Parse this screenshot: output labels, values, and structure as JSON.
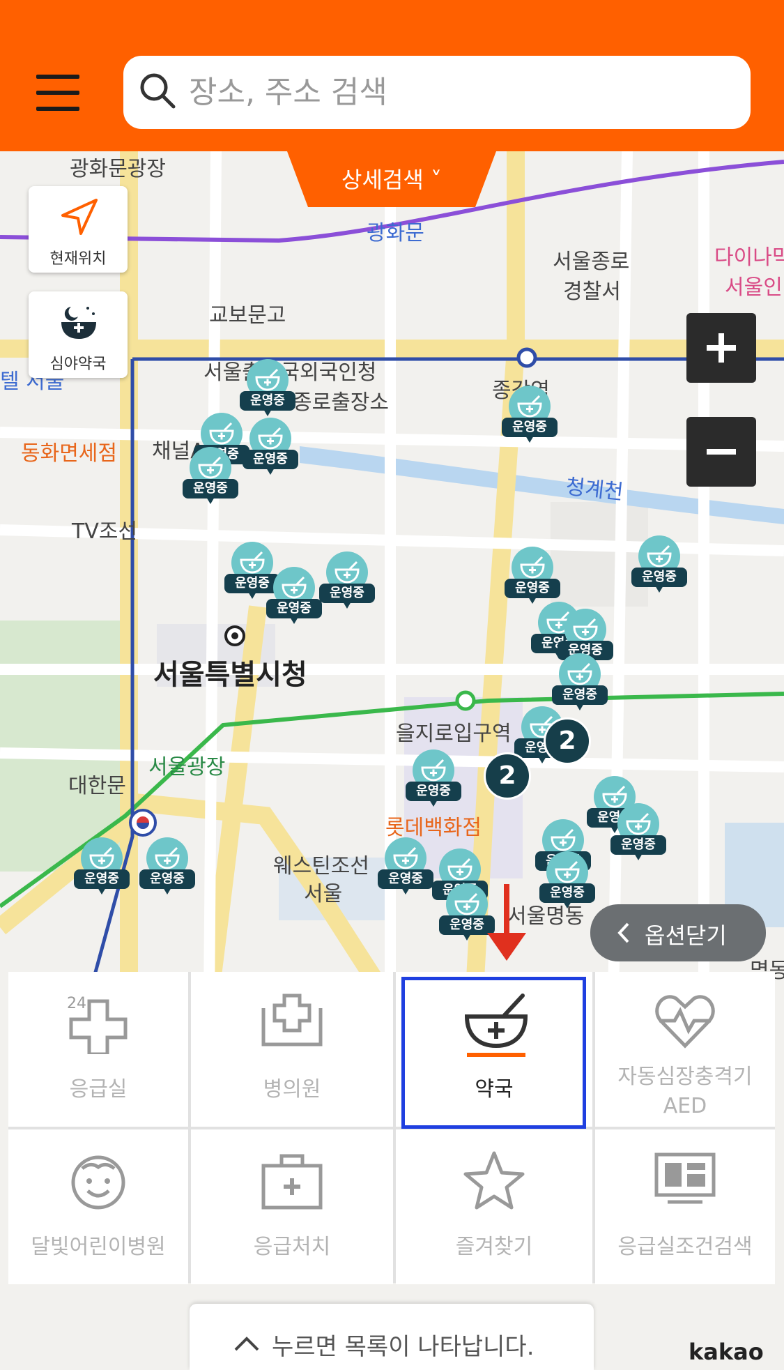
{
  "header": {
    "search_placeholder": "장소, 주소 검색",
    "detail_search_label": "상세검색",
    "brand_color": "#ff6000"
  },
  "side_buttons": {
    "current_location": "현재위치",
    "night_pharmacy": "심야약국"
  },
  "zoom": {
    "in_label": "+",
    "out_label": "−"
  },
  "map_labels": {
    "gwanghwamun_plaza": "광화문광장",
    "gwanghwamun": "광화문",
    "jongno_police": "서울종로",
    "jongno_police_2": "경찰서",
    "daiso": "다이나믹",
    "daiso_2": "서울인",
    "kyobo": "교보문고",
    "immigration": "서울출입국외국인청",
    "jongno_office": "종로출장소",
    "jonggak": "종각역",
    "channel_a": "채널A",
    "donghwa": "동화면세점",
    "cheonggyecheon": "청계천",
    "tv_chosun": "TV조선",
    "city_hall": "서울특별시청",
    "euljiro": "을지로입구역",
    "seoul_plaza": "서울광장",
    "daehanmun": "대한문",
    "lotte": "롯데백화점",
    "westin": "웨스틴조선",
    "westin_2": "서울",
    "myeongdong": "서울명동",
    "myeongdong_edge": "명동",
    "hotel": "텔 서울"
  },
  "pin_label": "운영중",
  "clusters": [
    "2",
    "2"
  ],
  "option_close": "옵션닫기",
  "categories": [
    {
      "label": "응급실",
      "icon": "emergency-24-icon",
      "active": false
    },
    {
      "label": "병의원",
      "icon": "hospital-icon",
      "active": false
    },
    {
      "label": "약국",
      "icon": "pharmacy-icon",
      "active": true
    },
    {
      "label": "자동심장충격기 AED",
      "icon": "heart-pulse-icon",
      "active": false
    },
    {
      "label": "달빛어린이병원",
      "icon": "child-face-icon",
      "active": false
    },
    {
      "label": "응급처치",
      "icon": "first-aid-kit-icon",
      "active": false
    },
    {
      "label": "즐겨찾기",
      "icon": "star-icon",
      "active": false
    },
    {
      "label": "응급실조건검색",
      "icon": "monitor-search-icon",
      "active": false
    }
  ],
  "bottom_hint": "누르면 목록이 나타납니다.",
  "attribution": "kakao"
}
